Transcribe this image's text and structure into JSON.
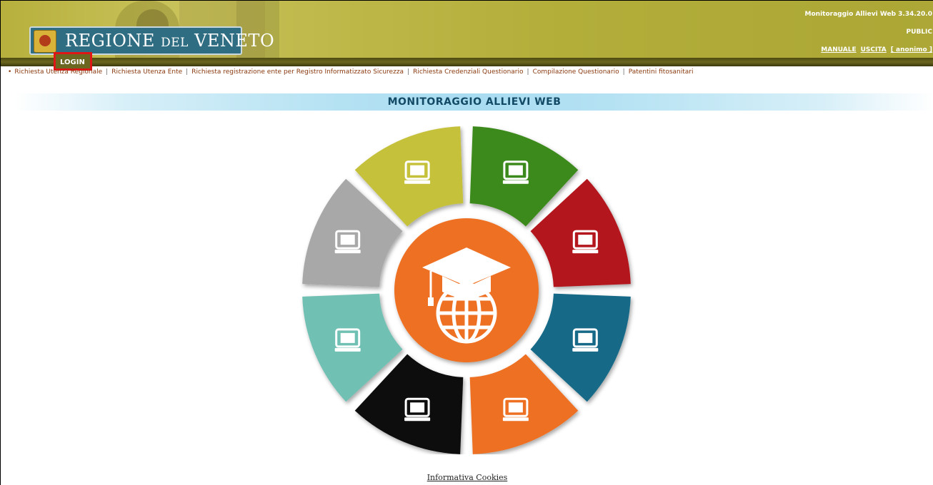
{
  "header": {
    "brand": {
      "text_main": "REGIONE",
      "text_small": "DEL",
      "text_end": "VENETO"
    },
    "version": "Monitoraggio Allievi Web 3.34.20.0",
    "access": "PUBLIC",
    "links": {
      "manual": "MANUALE",
      "exit": "USCITA",
      "user": "[ anonimo ]"
    },
    "login_label": "LOGIN"
  },
  "nav": {
    "items": [
      "Richiesta Utenza Regionale",
      "Richiesta Utenza Ente",
      "Richiesta registrazione ente per Registro Informatizzato Sicurezza",
      "Richiesta Credenziali Questionario",
      "Compilazione Questionario",
      "Patentini fitosanitari"
    ]
  },
  "main": {
    "title": "MONITORAGGIO ALLIEVI WEB",
    "wheel": {
      "center_color": "#ee6f22",
      "segments": [
        {
          "icon": "globe-flask-book-icon",
          "color": "#3d8a1a"
        },
        {
          "icon": "laptop-lightbulb-icon",
          "color": "#b3141b"
        },
        {
          "icon": "book-globe-icon",
          "color": "#136a87"
        },
        {
          "icon": "tablet-touch-icon",
          "color": "#ee6f22"
        },
        {
          "icon": "teacher-board-icon",
          "color": "#111111"
        },
        {
          "icon": "tablet-screen-icon",
          "color": "#6fc0b3"
        },
        {
          "icon": "tablet-atom-flask-icon",
          "color": "#a8a8a8"
        },
        {
          "icon": "globe-apple-book-icon",
          "color": "#c5c13a"
        }
      ]
    }
  },
  "footer": {
    "cookies_link": "Informativa Cookies"
  }
}
